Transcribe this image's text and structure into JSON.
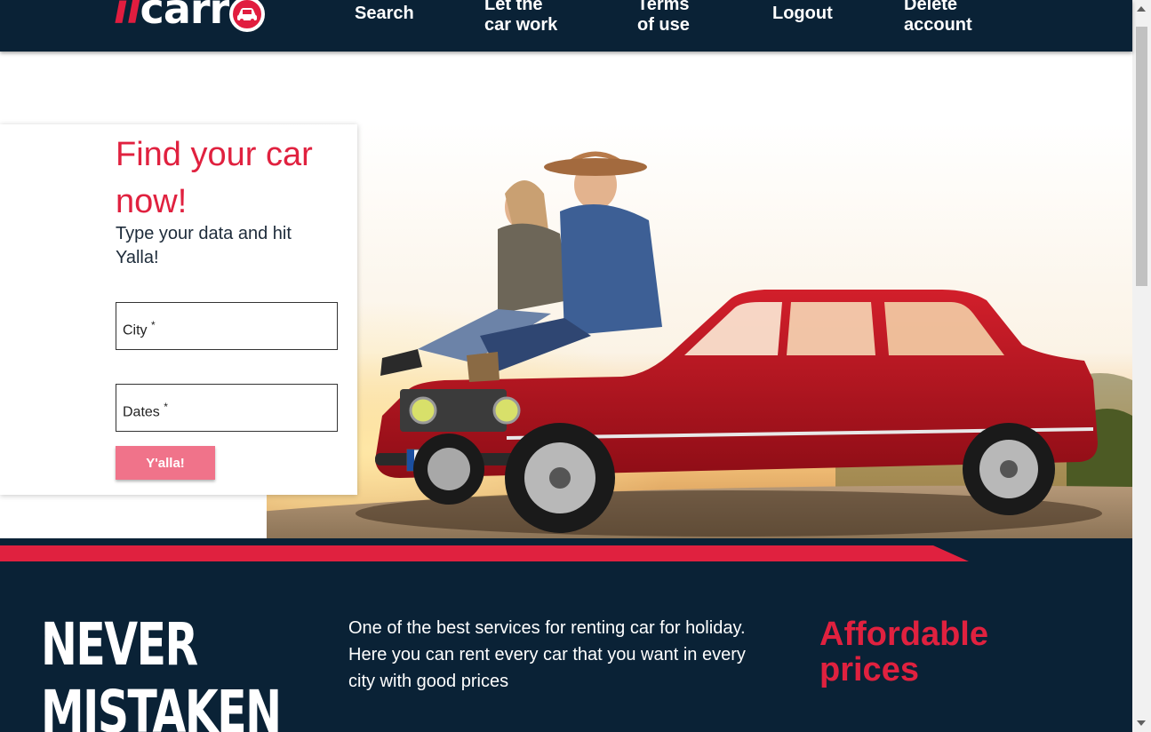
{
  "header": {
    "logo_il": "il",
    "logo_carr": "carr",
    "nav": [
      {
        "label": "Search"
      },
      {
        "label": "Let the car work"
      },
      {
        "label": "Terms of use"
      },
      {
        "label": "Logout"
      },
      {
        "label": "Delete account"
      }
    ]
  },
  "search": {
    "title": "Find your car now!",
    "subtitle": "Type your data and hit Yalla!",
    "city_label": "City",
    "dates_label": "Dates",
    "required_mark": "*",
    "submit_label": "Y'alla!"
  },
  "band": {
    "slogan_line1": "NEVER",
    "slogan_line2": "MISTAKEN",
    "about": "One of the best services for renting car for holiday. Here you can rent every car that you want in every city with good prices",
    "feature_title": "Affordable prices"
  },
  "colors": {
    "navy": "#0a2236",
    "accent_red": "#e0213f",
    "button_pink": "#f0738a"
  },
  "icons": [
    "car-logo-icon",
    "chevron-up-icon",
    "chevron-down-icon"
  ]
}
